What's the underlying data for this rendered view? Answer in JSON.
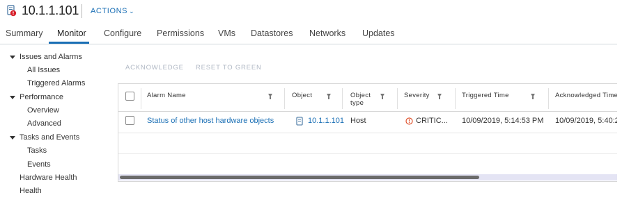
{
  "header": {
    "host_name": "10.1.1.101",
    "actions_label": "ACTIONS",
    "host_icon": "host-alert-icon",
    "chevron_icon": "chevron-down-icon"
  },
  "tabs": [
    {
      "label": "Summary"
    },
    {
      "label": "Monitor",
      "active": true
    },
    {
      "label": "Configure"
    },
    {
      "label": "Permissions"
    },
    {
      "label": "VMs"
    },
    {
      "label": "Datastores"
    },
    {
      "label": "Networks"
    },
    {
      "label": "Updates"
    }
  ],
  "sidebar": {
    "issues_and_alarms": "Issues and Alarms",
    "all_issues": "All Issues",
    "triggered_alarms": "Triggered Alarms",
    "performance": "Performance",
    "overview": "Overview",
    "advanced": "Advanced",
    "tasks_and_events": "Tasks and Events",
    "tasks": "Tasks",
    "events": "Events",
    "hardware_health": "Hardware Health",
    "health": "Health"
  },
  "toolbar": {
    "acknowledge": "ACKNOWLEDGE",
    "reset_to_green": "RESET TO GREEN"
  },
  "grid": {
    "columns": {
      "alarm_name": "Alarm Name",
      "object": "Object",
      "object_type_1": "Object",
      "object_type_2": "type",
      "severity": "Severity",
      "triggered_time": "Triggered Time",
      "acknowledged_time": "Acknowledged Time"
    },
    "rows": [
      {
        "alarm_name": "Status of other host hardware objects",
        "object": "10.1.1.101",
        "object_type": "Host",
        "severity": "CRITIC...",
        "triggered_time": "10/09/2019, 5:14:53 PM",
        "acknowledged_time": "10/09/2019, 5:40:2"
      }
    ]
  },
  "colors": {
    "accent": "#1a6fb5",
    "critical": "#e0522d",
    "disabled": "#b0b8c4"
  }
}
